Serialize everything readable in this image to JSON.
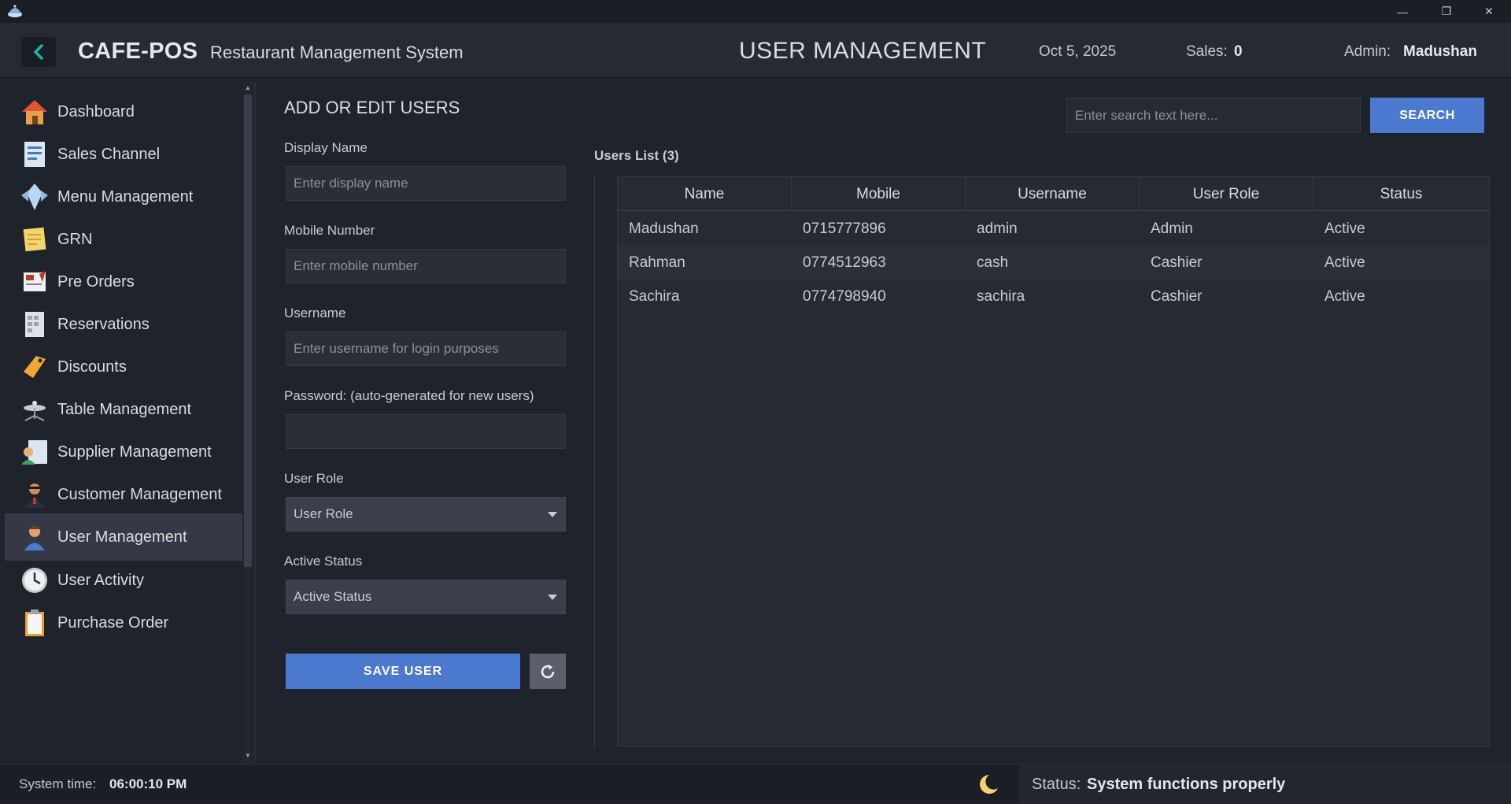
{
  "window": {
    "minimize_glyph": "—",
    "restore_glyph": "❐",
    "close_glyph": "✕"
  },
  "header": {
    "brand": "CAFE-POS",
    "subtitle": "Restaurant Management System",
    "page_title": "USER MANAGEMENT",
    "date": "Oct 5, 2025",
    "sales_label": "Sales:",
    "sales_value": "0",
    "admin_label": "Admin:",
    "admin_value": "Madushan"
  },
  "sidebar": {
    "items": [
      {
        "label": "Dashboard",
        "icon": "house-icon"
      },
      {
        "label": "Sales Channel",
        "icon": "receipt-icon"
      },
      {
        "label": "Menu Management",
        "icon": "menu-icon"
      },
      {
        "label": "GRN",
        "icon": "notepad-icon"
      },
      {
        "label": "Pre Orders",
        "icon": "order-form-icon"
      },
      {
        "label": "Reservations",
        "icon": "calendar-icon"
      },
      {
        "label": "Discounts",
        "icon": "tag-icon"
      },
      {
        "label": "Table Management",
        "icon": "table-icon"
      },
      {
        "label": "Supplier Management",
        "icon": "supplier-icon"
      },
      {
        "label": "Customer Management",
        "icon": "customer-icon"
      },
      {
        "label": "User Management",
        "icon": "user-icon"
      },
      {
        "label": "User Activity",
        "icon": "clock-icon"
      },
      {
        "label": "Purchase Order",
        "icon": "clipboard-icon"
      }
    ],
    "active_index": 10
  },
  "form": {
    "title": "ADD OR EDIT USERS",
    "display_name_label": "Display Name",
    "display_name_placeholder": "Enter display name",
    "mobile_label": "Mobile Number",
    "mobile_placeholder": "Enter mobile number",
    "username_label": "Username",
    "username_placeholder": "Enter username for login purposes",
    "password_label": "Password: (auto-generated for new users)",
    "password_value": "",
    "role_label": "User Role",
    "role_value": "User Role",
    "status_label": "Active Status",
    "status_value": "Active Status",
    "save_label": "SAVE USER"
  },
  "search": {
    "placeholder": "Enter search text here...",
    "button_label": "SEARCH"
  },
  "users": {
    "title": "Users List (3)",
    "columns": [
      "Name",
      "Mobile",
      "Username",
      "User Role",
      "Status"
    ],
    "rows": [
      [
        "Madushan",
        "0715777896",
        "admin",
        "Admin",
        "Active"
      ],
      [
        "Rahman",
        "0774512963",
        "cash",
        "Cashier",
        "Active"
      ],
      [
        "Sachira",
        "0774798940",
        "sachira",
        "Cashier",
        "Active"
      ]
    ]
  },
  "statusbar": {
    "time_label": "System time:",
    "time_value": "06:00:10 PM",
    "status_label": "Status:",
    "status_value": "System functions properly"
  },
  "colors": {
    "accent": "#4b79cf",
    "back_arrow": "#1fb5a8",
    "moon": "#f5d36b"
  }
}
